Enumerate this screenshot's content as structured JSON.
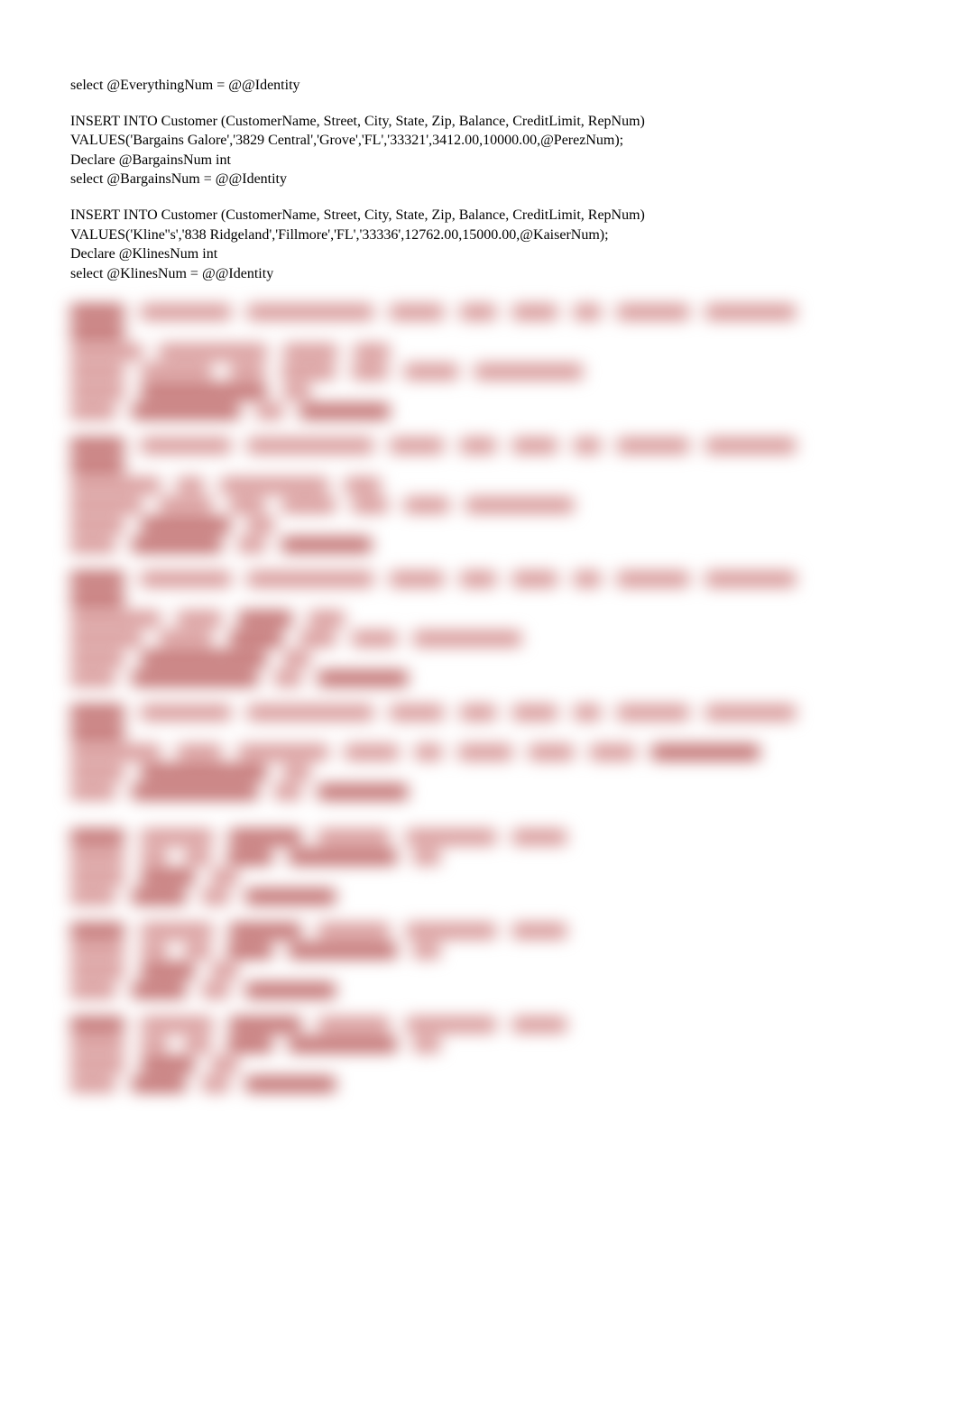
{
  "code": {
    "l1": "select @EverythingNum = @@Identity",
    "l2": "",
    "l3": "INSERT INTO Customer (CustomerName, Street, City, State, Zip, Balance, CreditLimit, RepNum)",
    "l4": "VALUES('Bargains Galore','3829 Central','Grove','FL','33321',3412.00,10000.00,@PerezNum);",
    "l5": "Declare @BargainsNum int",
    "l6": "select @BargainsNum = @@Identity",
    "l7": "",
    "l8": "INSERT INTO Customer (CustomerName, Street, City, State, Zip, Balance, CreditLimit, RepNum)",
    "l9": "VALUES('Kline''s','838 Ridgeland','Fillmore','FL','33336',12762.00,15000.00,@KaiserNum);",
    "l10": "Declare @KlinesNum int",
    "l11": "select @KlinesNum = @@Identity"
  }
}
